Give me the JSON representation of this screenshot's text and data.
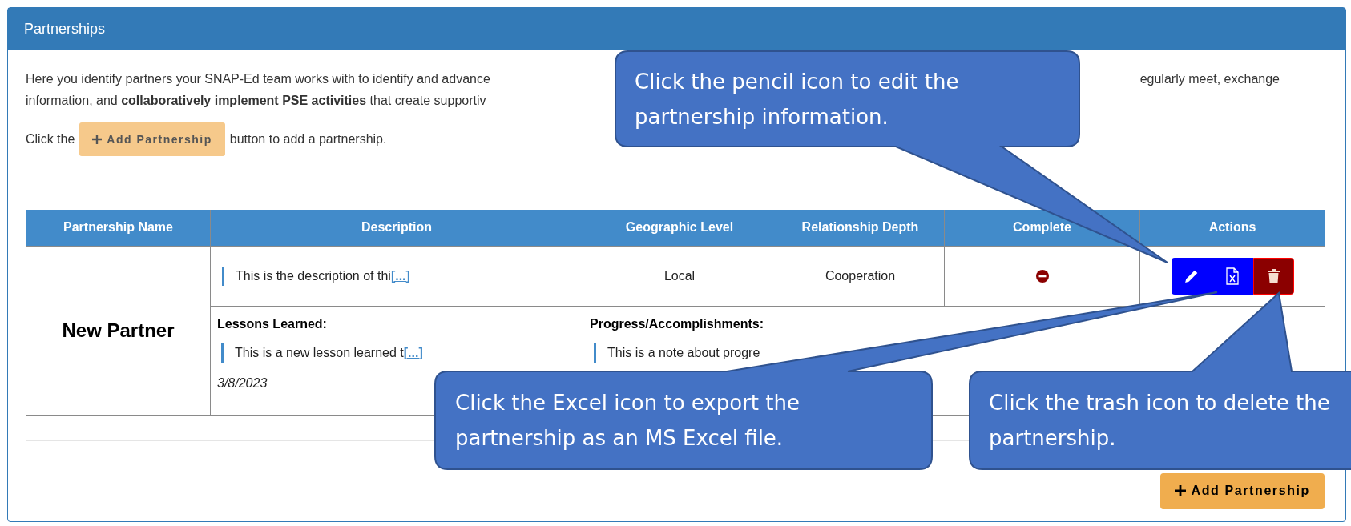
{
  "panel": {
    "title": "Partnerships",
    "intro_lines": [
      {
        "left": "Here you identify partners your SNAP-Ed team works with to identify and advance",
        "right": "egularly meet, exchange"
      },
      {
        "left": "information, and **collaboratively implement PSE activities** that create supportiv"
      }
    ],
    "add_hint": {
      "before": "Click the",
      "button": "Add Partnership",
      "after": "button to add a partnership."
    },
    "table": {
      "columns": [
        "Partnership Name",
        "Description",
        "Geographic Level",
        "Relationship Depth",
        "Complete",
        "Actions"
      ],
      "rows": [
        {
          "name": "New Partner",
          "description": "This is the description of thi",
          "description_more": "[...]",
          "geographic_level": "Local",
          "relationship_depth": "Cooperation",
          "complete": false,
          "actions": [
            {
              "kind": "edit"
            },
            {
              "kind": "excel"
            },
            {
              "kind": "delete"
            }
          ],
          "lessons_label": "Lessons Learned:",
          "lesson": "This is a new lesson learned t",
          "lesson_more": "[...]",
          "lesson_date": "3/8/2023",
          "progress_label": "Progress/Accomplishments:",
          "progress_note": "This is a note about progre"
        }
      ]
    },
    "add_button": "Add Partnership"
  },
  "callouts": [
    {
      "text": "Click the pencil icon to edit the partnership information."
    },
    {
      "text": "Click the Excel icon to export the partnership as an MS Excel file."
    },
    {
      "text": "Click the trash icon to delete the partnership."
    }
  ]
}
